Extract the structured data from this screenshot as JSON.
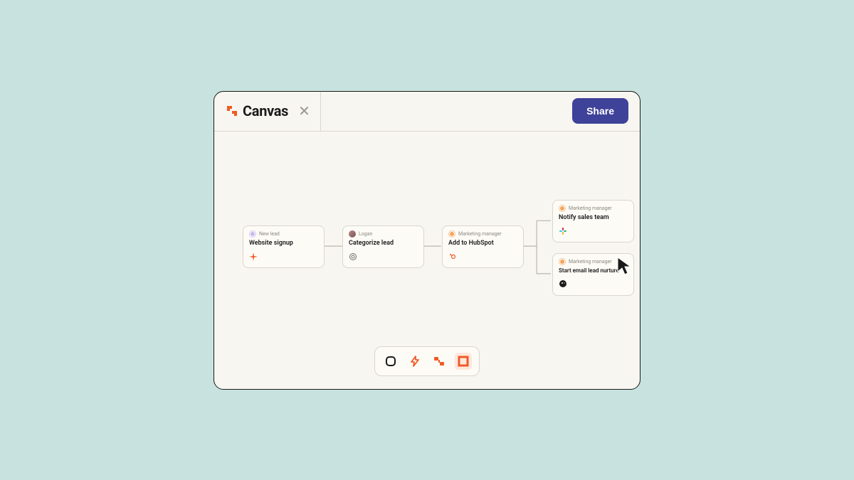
{
  "app": {
    "name": "Canvas",
    "share_label": "Share"
  },
  "nodes": {
    "n1": {
      "role": "New lead",
      "title": "Website signup",
      "integration": "zapier"
    },
    "n2": {
      "role": "Logan",
      "title": "Categorize lead",
      "integration": "openai"
    },
    "n3": {
      "role": "Marketing manager",
      "title": "Add to HubSpot",
      "integration": "hubspot"
    },
    "n4": {
      "role": "Marketing manager",
      "title": "Notify sales team",
      "integration": "slack"
    },
    "n5": {
      "role": "Marketing manager",
      "title": "Start email lead nurture",
      "integration": "mailchimp"
    }
  },
  "toolbar": {
    "tools": [
      "square",
      "bolt",
      "flow",
      "frame"
    ]
  }
}
